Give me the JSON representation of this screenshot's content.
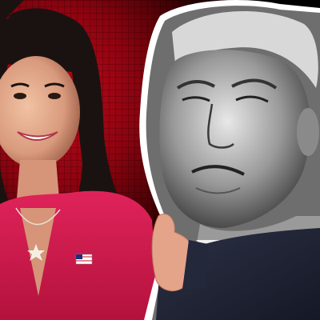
{
  "image": {
    "background_colors": {
      "accent_red": "#c4081a",
      "dark_red": "#8a0410",
      "black": "#000000"
    },
    "subjects": [
      {
        "name": "woman-portrait",
        "description_tone": "color",
        "dress_color": "#d3194a"
      },
      {
        "name": "man-portrait",
        "description_tone": "grayscale"
      }
    ]
  }
}
